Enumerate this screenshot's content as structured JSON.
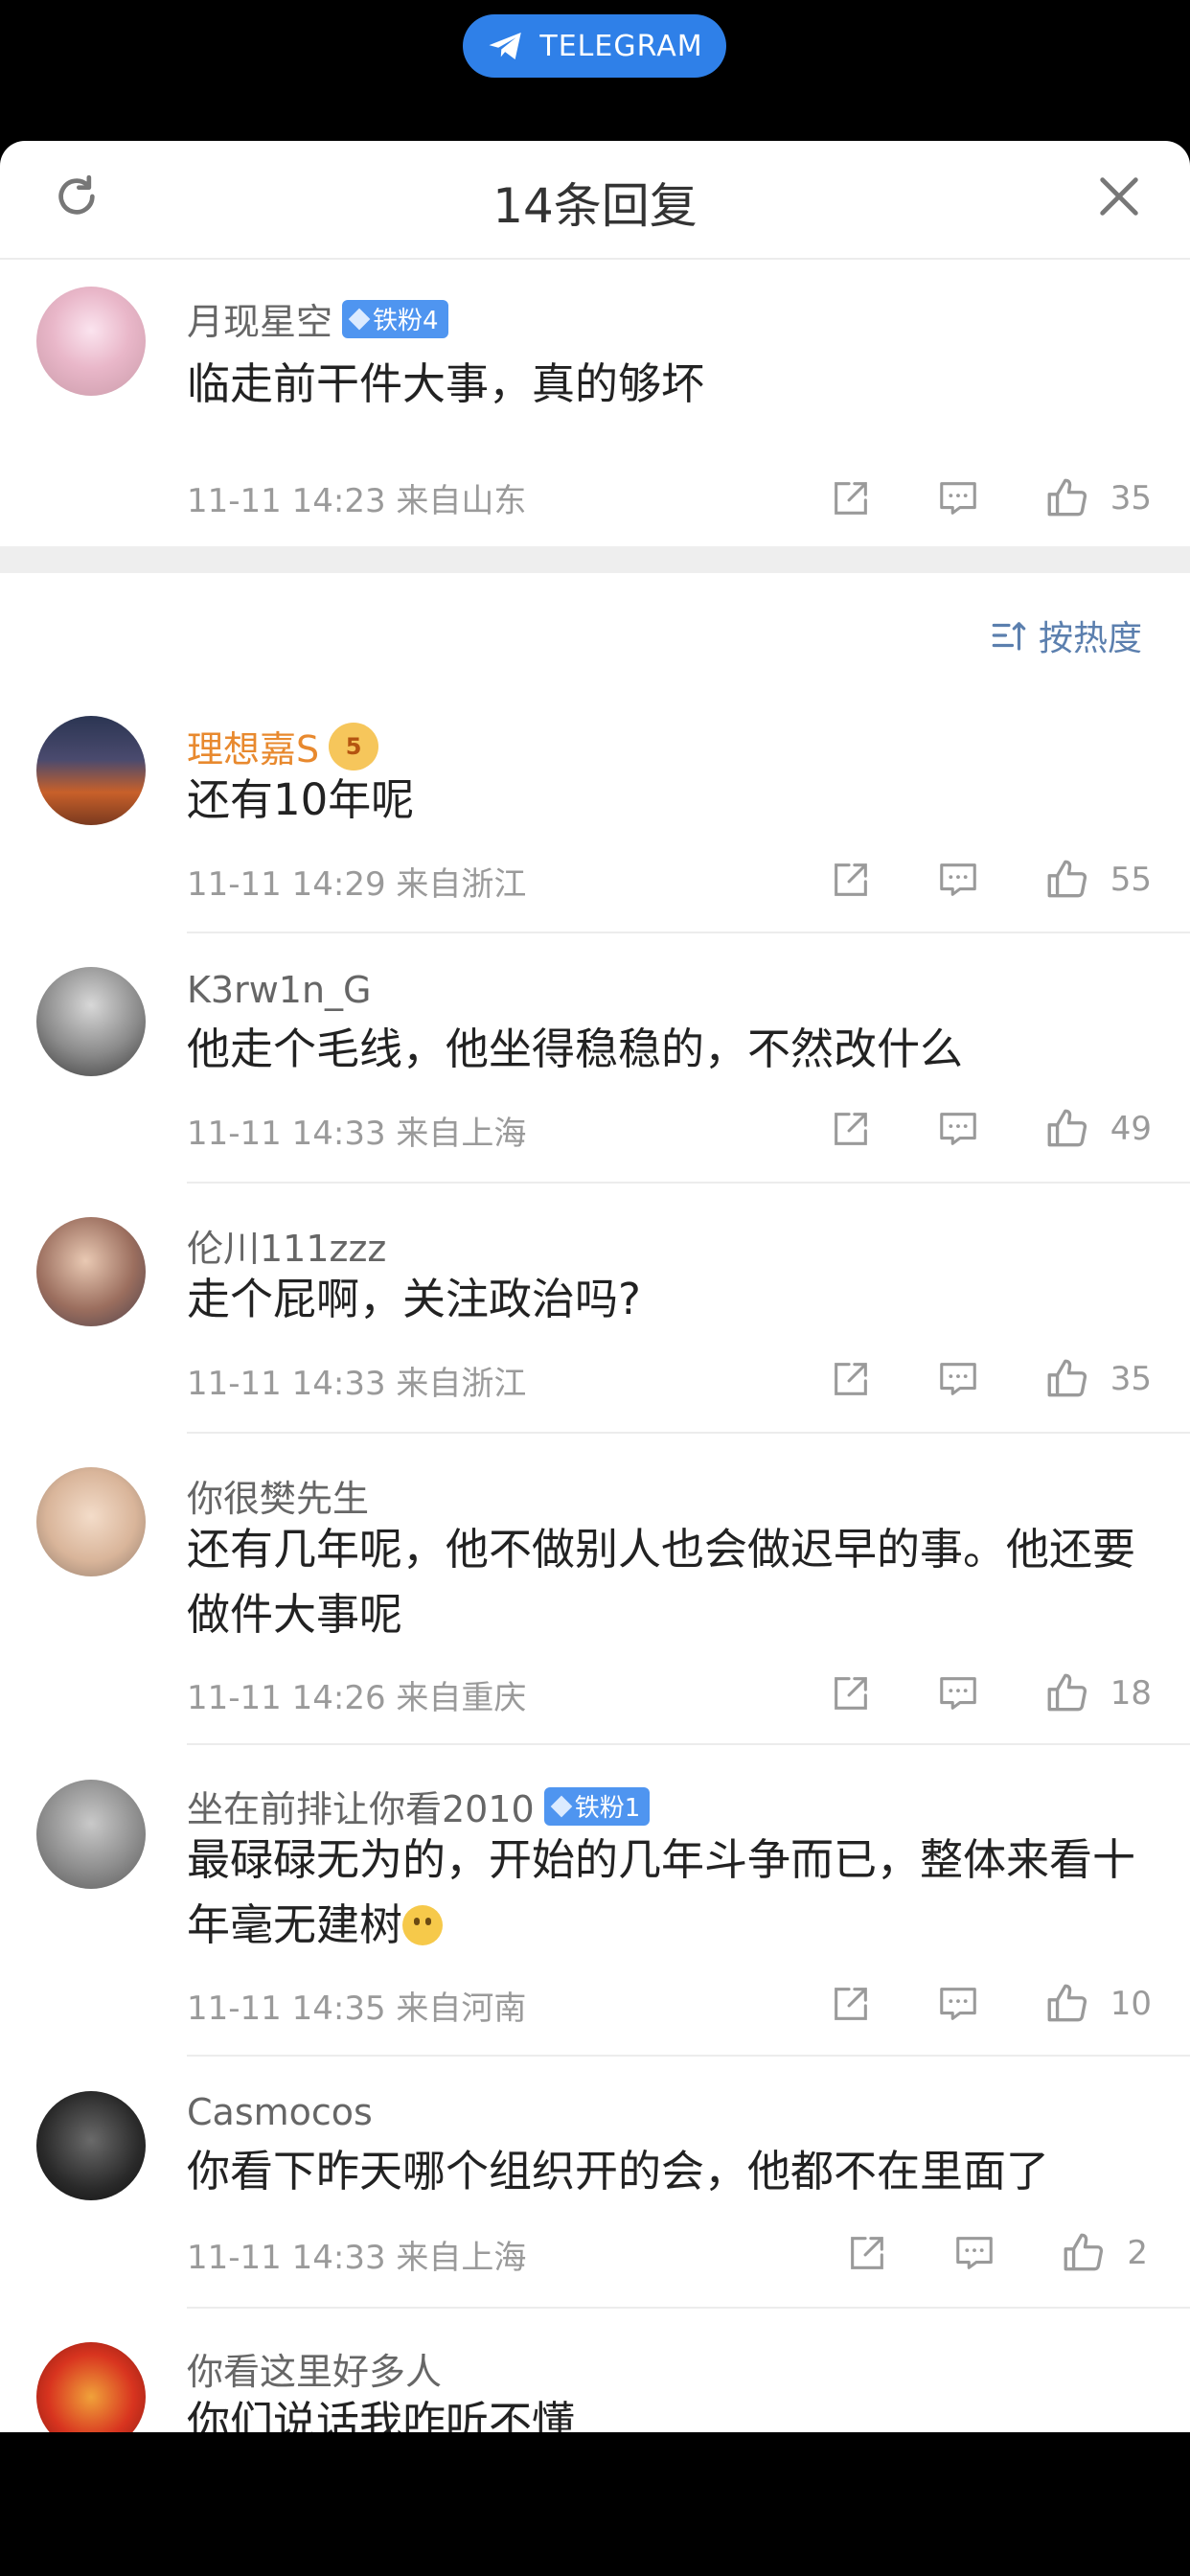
{
  "telegram": {
    "label": "TELEGRAM"
  },
  "header": {
    "title": "14条回复",
    "refresh_icon": "refresh-icon",
    "close_icon": "close-icon"
  },
  "sort": {
    "label": "按热度",
    "icon": "sort-icon"
  },
  "main_comment": {
    "name": "月现星空",
    "badge": "铁粉4",
    "text": "临走前干件大事，真的够坏",
    "meta": "11-11 14:23  来自山东",
    "likes": "35"
  },
  "replies": [
    {
      "name": "理想嘉S",
      "crown": "5",
      "text": "还有10年呢",
      "meta": "11-11 14:29  来自浙江",
      "likes": "55"
    },
    {
      "name": "K3rw1n_G",
      "text": "他走个毛线，他坐得稳稳的，不然改什么",
      "meta": "11-11 14:33  来自上海",
      "likes": "49"
    },
    {
      "name": "伦川111zzz",
      "text": "走个屁啊，关注政治吗?",
      "meta": "11-11 14:33  来自浙江",
      "likes": "35"
    },
    {
      "name": "你很樊先生",
      "text": "还有几年呢，他不做别人也会做迟早的事。他还要做件大事呢",
      "meta": "11-11 14:26  来自重庆",
      "likes": "18"
    },
    {
      "name": "坐在前排让你看2010",
      "badge": "铁粉1",
      "text": "最碌碌无为的，开始的几年斗争而已，整体来看十年毫无建树",
      "meta": "11-11 14:35  来自河南",
      "likes": "10"
    },
    {
      "name": "Casmocos",
      "text": "你看下昨天哪个组织开的会，他都不在里面了",
      "meta": "11-11 14:33  来自上海",
      "likes": "2"
    },
    {
      "name": "你看这里好多人",
      "text": "你们说话我咋听不懂",
      "meta": "",
      "likes": ""
    }
  ]
}
